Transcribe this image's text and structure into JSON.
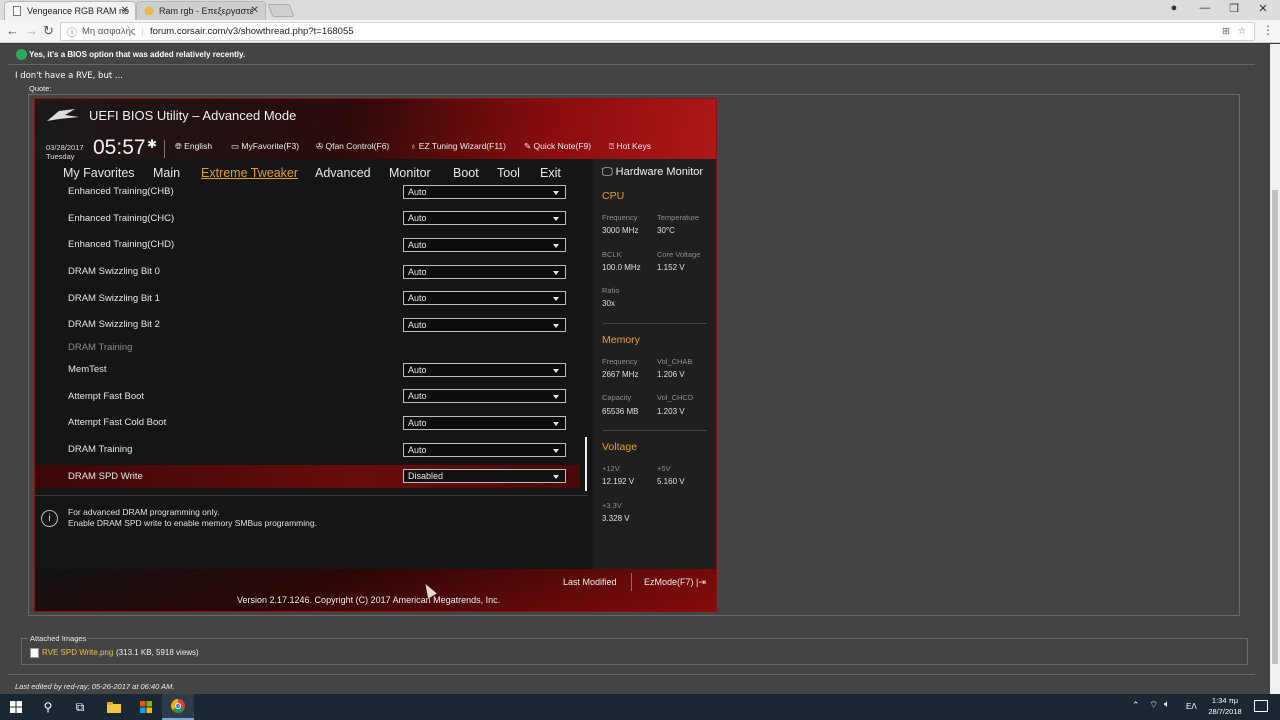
{
  "browser": {
    "tabs": [
      {
        "title": "Vengeance RGB RAM no",
        "active": true
      },
      {
        "title": "Ram rgb - Επεξεργαστέ",
        "active": false
      }
    ],
    "security_label": "Μη ασφαλής",
    "url": "forum.corsair.com/v3/showthread.php?t=168055"
  },
  "post": {
    "answer_text": "Yes, it's a BIOS option that was added relatively recently.",
    "reply_text": "I don't have a RVE, but ...",
    "quote_label": "Quote:",
    "attached_label": "Attached Images",
    "attachment_name": "RVE SPD Write.png",
    "attachment_meta": "(313.1 KB, 5918 views)",
    "edit_note": "Last edited by red-ray; 05-26-2017 at 06:40 AM."
  },
  "bios": {
    "title": "UEFI BIOS Utility – Advanced Mode",
    "date": "03/28/2017",
    "day": "Tuesday",
    "time": "05:57",
    "toolbar": {
      "language": "English",
      "myfavorite": "MyFavorite(F3)",
      "qfan": "Qfan Control(F6)",
      "ez_tuning": "EZ Tuning Wizard(F11)",
      "quick_note": "Quick Note(F9)",
      "hot_keys": "Hot Keys"
    },
    "menu": [
      "My Favorites",
      "Main",
      "Extreme Tweaker",
      "Advanced",
      "Monitor",
      "Boot",
      "Tool",
      "Exit"
    ],
    "active_menu": "Extreme Tweaker",
    "rows": [
      {
        "label": "Enhanced Training(CHB)",
        "value": "Auto"
      },
      {
        "label": "Enhanced Training(CHC)",
        "value": "Auto"
      },
      {
        "label": "Enhanced Training(CHD)",
        "value": "Auto"
      },
      {
        "label": "DRAM Swizzling Bit 0",
        "value": "Auto"
      },
      {
        "label": "DRAM Swizzling Bit 1",
        "value": "Auto"
      },
      {
        "label": "DRAM Swizzling Bit 2",
        "value": "Auto"
      }
    ],
    "section_header": "DRAM Training",
    "rows2": [
      {
        "label": "MemTest",
        "value": "Auto"
      },
      {
        "label": "Attempt Fast Boot",
        "value": "Auto"
      },
      {
        "label": "Attempt Fast Cold Boot",
        "value": "Auto"
      },
      {
        "label": "DRAM Training",
        "value": "Auto"
      }
    ],
    "selected_row": {
      "label": "DRAM SPD Write",
      "value": "Disabled"
    },
    "help_line1": "For advanced DRAM programming only.",
    "help_line2": "Enable DRAM SPD write to enable memory SMBus programming.",
    "footer_last_modified": "Last Modified",
    "footer_ezmode": "EzMode(F7)",
    "version": "Version 2.17.1246. Copyright (C) 2017 American Megatrends, Inc.",
    "hw_monitor": {
      "title": "Hardware Monitor",
      "cpu_title": "CPU",
      "cpu": {
        "frequency_label": "Frequency",
        "frequency": "3000 MHz",
        "temperature_label": "Temperature",
        "temperature": "30°C",
        "bclk_label": "BCLK",
        "bclk": "100.0 MHz",
        "core_voltage_label": "Core Voltage",
        "core_voltage": "1.152 V",
        "ratio_label": "Ratio",
        "ratio": "30x"
      },
      "memory_title": "Memory",
      "memory": {
        "frequency_label": "Frequency",
        "frequency": "2667 MHz",
        "vol_chab_label": "Vol_CHAB",
        "vol_chab": "1.206 V",
        "capacity_label": "Capacity",
        "capacity": "65536 MB",
        "vol_chcd_label": "Vol_CHCD",
        "vol_chcd": "1.203 V"
      },
      "voltage_title": "Voltage",
      "voltage": {
        "v12_label": "+12V",
        "v12": "12.192 V",
        "v5_label": "+5V",
        "v5": "5.160 V",
        "v33_label": "+3.3V",
        "v33": "3.328 V"
      }
    }
  },
  "taskbar": {
    "language": "ΕΛ",
    "time": "1:34 πμ",
    "date": "28/7/2018"
  },
  "colors": {
    "bios_accent": "#e0a030",
    "bios_red": "#8b1010",
    "link_yellow": "#e8c24a"
  }
}
